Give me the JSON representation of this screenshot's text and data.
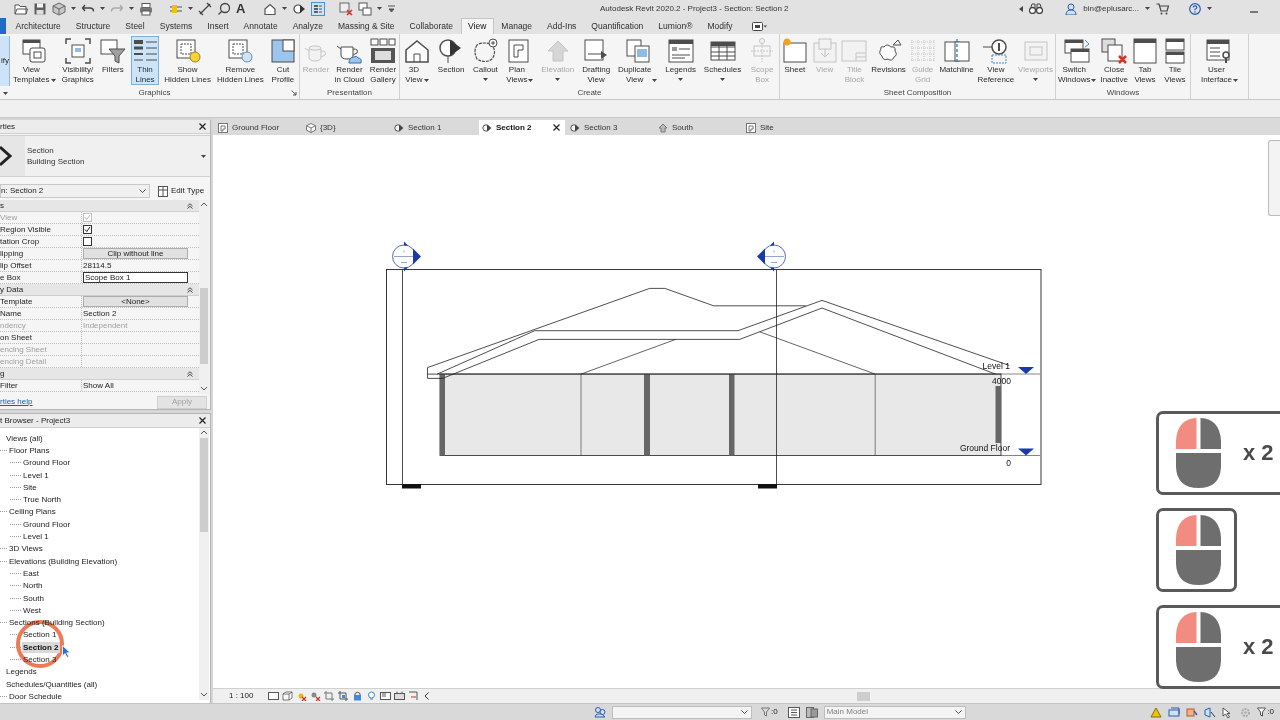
{
  "title_bar": {
    "text_tool": "A",
    "thin_lines_on": true,
    "title": "Autodesk Revit 2020.2 - Project3 - Section: Section 2",
    "user": "bin@eplusarc..."
  },
  "ribbon_tabs": [
    {
      "label": "Architecture",
      "selected": false
    },
    {
      "label": "Structure",
      "selected": false
    },
    {
      "label": "Steel",
      "selected": false
    },
    {
      "label": "Systems",
      "selected": false
    },
    {
      "label": "Insert",
      "selected": false
    },
    {
      "label": "Annotate",
      "selected": false
    },
    {
      "label": "Analyze",
      "selected": false
    },
    {
      "label": "Massing & Site",
      "selected": false
    },
    {
      "label": "Collaborate",
      "selected": false
    },
    {
      "label": "View",
      "selected": true
    },
    {
      "label": "Manage",
      "selected": false
    },
    {
      "label": "Add-Ins",
      "selected": false
    },
    {
      "label": "Quantification",
      "selected": false
    },
    {
      "label": "Lumion®",
      "selected": false
    },
    {
      "label": "Modify",
      "selected": false
    }
  ],
  "ribbon": {
    "modify_button": "ify",
    "panels": [
      {
        "title": "Graphics",
        "launcher": true,
        "buttons": [
          {
            "label": "View\nTemplates",
            "dropdown": true,
            "on": false,
            "disabled": false
          },
          {
            "label": "Visibility/\nGraphics",
            "dropdown": false,
            "on": false,
            "disabled": false
          },
          {
            "label": "Filters",
            "dropdown": false,
            "on": false,
            "disabled": false
          },
          {
            "label": "Thin\nLines",
            "dropdown": false,
            "on": true,
            "disabled": false
          },
          {
            "label": "Show\nHidden Lines",
            "dropdown": false,
            "on": false,
            "disabled": false
          },
          {
            "label": "Remove\nHidden Lines",
            "dropdown": false,
            "on": false,
            "disabled": false
          },
          {
            "label": "Cut\nProfile",
            "dropdown": false,
            "on": false,
            "disabled": false
          }
        ]
      },
      {
        "title": "Presentation",
        "launcher": false,
        "buttons": [
          {
            "label": "Render",
            "dropdown": false,
            "on": false,
            "disabled": true
          },
          {
            "label": "Render\nin Cloud",
            "dropdown": false,
            "on": false,
            "disabled": false
          },
          {
            "label": "Render\nGallery",
            "dropdown": false,
            "on": false,
            "disabled": false
          }
        ]
      },
      {
        "title": "Create",
        "launcher": false,
        "buttons": [
          {
            "label": "3D\nView",
            "dropdown": true,
            "on": false,
            "disabled": false
          },
          {
            "label": "Section",
            "dropdown": false,
            "on": false,
            "disabled": false
          },
          {
            "label": "Callout",
            "dropdown": true,
            "on": false,
            "disabled": false
          },
          {
            "label": "Plan\nViews",
            "dropdown": true,
            "on": false,
            "disabled": false
          },
          {
            "label": "Elevation",
            "dropdown": true,
            "on": false,
            "disabled": true
          },
          {
            "label": "Drafting\nView",
            "dropdown": false,
            "on": false,
            "disabled": false
          },
          {
            "label": "Duplicate\nView",
            "dropdown": true,
            "on": false,
            "disabled": false
          },
          {
            "label": "Legends",
            "dropdown": true,
            "on": false,
            "disabled": false
          },
          {
            "label": "Schedules",
            "dropdown": true,
            "on": false,
            "disabled": false
          },
          {
            "label": "Scope\nBox",
            "dropdown": false,
            "on": false,
            "disabled": true
          }
        ]
      },
      {
        "title": "Sheet Composition",
        "launcher": false,
        "buttons": [
          {
            "label": "Sheet",
            "dropdown": false,
            "on": false,
            "disabled": false
          },
          {
            "label": "View",
            "dropdown": false,
            "on": false,
            "disabled": true
          },
          {
            "label": "Title\nBlock",
            "dropdown": false,
            "on": false,
            "disabled": true
          },
          {
            "label": "Revisions",
            "dropdown": false,
            "on": false,
            "disabled": false
          },
          {
            "label": "Guide\nGrid",
            "dropdown": false,
            "on": false,
            "disabled": true
          },
          {
            "label": "Matchline",
            "dropdown": false,
            "on": false,
            "disabled": false
          },
          {
            "label": "View\nReference",
            "dropdown": false,
            "on": false,
            "disabled": false
          },
          {
            "label": "Viewports",
            "dropdown": true,
            "on": false,
            "disabled": true
          }
        ]
      },
      {
        "title": "Windows",
        "launcher": false,
        "buttons": [
          {
            "label": "Switch\nWindows",
            "dropdown": true,
            "on": false,
            "disabled": false
          },
          {
            "label": "Close\nInactive",
            "dropdown": false,
            "on": false,
            "disabled": false
          },
          {
            "label": "Tab\nViews",
            "dropdown": false,
            "on": false,
            "disabled": false
          },
          {
            "label": "Tile\nViews",
            "dropdown": false,
            "on": false,
            "disabled": false
          }
        ]
      },
      {
        "launcher": false,
        "buttons": [
          {
            "label": "User\nInterface",
            "dropdown": true,
            "on": false,
            "disabled": false
          }
        ]
      }
    ]
  },
  "properties": {
    "title": "rties",
    "type_name": "Section",
    "type_family": "Building Section",
    "instance": "n: Section 2",
    "edit_type": "Edit Type",
    "rows": [
      {
        "kind": "group",
        "label": "s",
        "disabled": false
      },
      {
        "kind": "checkbox",
        "label": "View",
        "checked": true,
        "disabled": true
      },
      {
        "kind": "checkbox",
        "label": "Region Visible",
        "checked": true,
        "disabled": false
      },
      {
        "kind": "checkbox",
        "label": "tation Crop",
        "checked": false,
        "disabled": false
      },
      {
        "kind": "button",
        "label": "lipping",
        "value": "Clip without line",
        "disabled": false
      },
      {
        "kind": "text",
        "label": "lip Offset",
        "value": "28114.5",
        "disabled": false
      },
      {
        "kind": "field",
        "label": "e Box",
        "value": "Scope Box 1",
        "disabled": false
      },
      {
        "kind": "group",
        "label": "y Data",
        "disabled": false
      },
      {
        "kind": "button",
        "label": "Template",
        "value": "<None>",
        "disabled": false
      },
      {
        "kind": "text",
        "label": "Name",
        "value": "Section 2",
        "disabled": false
      },
      {
        "kind": "text",
        "label": "ndency",
        "value": "Independent",
        "disabled": true
      },
      {
        "kind": "text",
        "label": "on Sheet",
        "disabled": false
      },
      {
        "kind": "text",
        "label": "encing Sheet",
        "disabled": true
      },
      {
        "kind": "text",
        "label": "encing Detail",
        "disabled": true
      },
      {
        "kind": "group",
        "label": "g",
        "disabled": false
      },
      {
        "kind": "text",
        "label": "Filter",
        "value": "Show All",
        "disabled": false
      }
    ],
    "help_link": "rties help",
    "apply": {
      "label": "Apply",
      "disabled": true
    }
  },
  "project_browser": {
    "title": "t Browser - Project3",
    "items": [
      {
        "label": "Views (all)",
        "selected": false,
        "children": [
          {
            "label": "Floor Plans",
            "selected": false,
            "children": [
              {
                "label": "Ground Floor",
                "selected": false
              },
              {
                "label": "Level 1",
                "selected": false
              },
              {
                "label": "Site",
                "selected": false
              },
              {
                "label": "True North",
                "selected": false
              }
            ]
          },
          {
            "label": "Ceiling Plans",
            "selected": false,
            "children": [
              {
                "label": "Ground Floor",
                "selected": false
              },
              {
                "label": "Level 1",
                "selected": false
              }
            ]
          },
          {
            "label": "3D Views",
            "selected": false
          },
          {
            "label": "Elevations (Building Elevation)",
            "selected": false,
            "children": [
              {
                "label": "East",
                "selected": false
              },
              {
                "label": "North",
                "selected": false
              },
              {
                "label": "South",
                "selected": false
              },
              {
                "label": "West",
                "selected": false
              }
            ]
          },
          {
            "label": "Sections (Building Section)",
            "selected": false,
            "children": [
              {
                "label": "Section 1",
                "selected": false
              },
              {
                "label": "Section 2",
                "selected": true
              },
              {
                "label": "Section 3",
                "selected": false
              }
            ]
          }
        ]
      },
      {
        "label": "Legends",
        "selected": false
      },
      {
        "label": "Schedules/Quantities (all)",
        "selected": false,
        "children": [
          {
            "label": "Door Schedule",
            "selected": false
          }
        ]
      }
    ]
  },
  "view_tabs": [
    {
      "label": "Ground Floor",
      "kind": "plan",
      "selected": false
    },
    {
      "label": "{3D}",
      "kind": "model",
      "selected": false
    },
    {
      "label": "Section 1",
      "kind": "section",
      "selected": false
    },
    {
      "label": "Section 2",
      "kind": "section",
      "selected": true
    },
    {
      "label": "Section 3",
      "kind": "section",
      "selected": false
    },
    {
      "label": "South",
      "kind": "elevation",
      "selected": false
    },
    {
      "label": "Site",
      "kind": "plan",
      "selected": false
    }
  ],
  "drawing": {
    "levels": [
      {
        "name": "Level 1",
        "elevation": "4000"
      },
      {
        "name": "Ground Floor",
        "elevation": "0"
      }
    ]
  },
  "view_control": {
    "scale": "1 : 100"
  },
  "status_bar": {
    "filter_count": ":0",
    "design_option": "Main Model",
    "selection_count": ":0"
  },
  "mouse_hints": [
    {
      "kind": "double",
      "label": "x 2"
    },
    {
      "kind": "single"
    },
    {
      "kind": "double",
      "label": "x 2"
    }
  ]
}
